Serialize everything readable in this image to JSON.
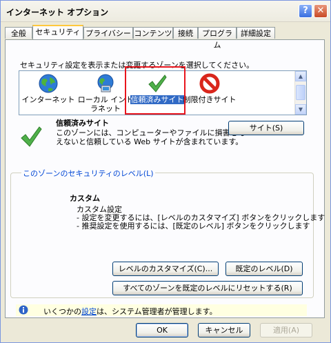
{
  "window": {
    "title": "インターネット オプション",
    "help_label": "?",
    "close_label": "✕"
  },
  "tabs": [
    {
      "label": "全般"
    },
    {
      "label": "セキュリティ"
    },
    {
      "label": "プライバシー"
    },
    {
      "label": "コンテンツ"
    },
    {
      "label": "接続"
    },
    {
      "label": "プログラム"
    },
    {
      "label": "詳細設定"
    }
  ],
  "instruction": "セキュリティ設定を表示または変更するゾーンを選択してください。",
  "zones": [
    {
      "line1": "インターネット",
      "line2": "",
      "icon": "globe-icon"
    },
    {
      "line1": "ローカル イント",
      "line2": "ラネット",
      "icon": "intranet-icon"
    },
    {
      "line1": "信頼済みサイト",
      "line2": "",
      "icon": "checkmark-icon"
    },
    {
      "line1": "制限付きサイト",
      "line2": "",
      "icon": "prohibited-icon"
    }
  ],
  "selected_zone": {
    "title": "信頼済みサイト",
    "desc1": "このゾーンには、コンピューターやファイルに損害を与",
    "desc2": "えないと信頼している Web サイトが含まれています。",
    "sites_button": "サイト(S)"
  },
  "security_level": {
    "group_label": "このゾーンのセキュリティのレベル(L)",
    "level_name": "カスタム",
    "line1": "カスタム設定",
    "line2": "- 設定を変更するには、[レベルのカスタマイズ] ボタンをクリックします",
    "line3": "- 推奨設定を使用するには、[既定のレベル] ボタンをクリックします",
    "customize_button": "レベルのカスタマイズ(C)...",
    "default_button": "既定のレベル(D)",
    "reset_all_button": "すべてのゾーンを既定のレベルにリセットする(R)"
  },
  "info": {
    "prefix": "いくつかの",
    "link": "設定",
    "suffix": "は、システム管理者が管理します。"
  },
  "footer": {
    "ok": "OK",
    "cancel": "キャンセル",
    "apply": "適用(A)"
  }
}
